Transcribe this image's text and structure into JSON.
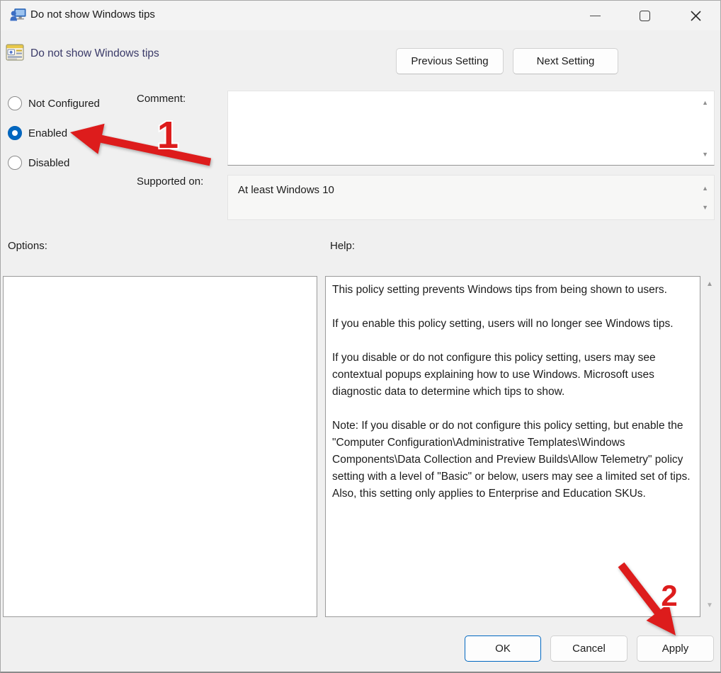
{
  "window": {
    "title": "Do not show Windows tips"
  },
  "header": {
    "title": "Do not show Windows tips",
    "previous_button": "Previous Setting",
    "next_button": "Next Setting"
  },
  "radios": {
    "selected": "Enabled",
    "items": [
      {
        "label": "Not Configured",
        "checked": false
      },
      {
        "label": "Enabled",
        "checked": true
      },
      {
        "label": "Disabled",
        "checked": false
      }
    ]
  },
  "comment": {
    "label": "Comment:",
    "value": ""
  },
  "supported": {
    "label": "Supported on:",
    "value": "At least Windows 10"
  },
  "options": {
    "label": "Options:"
  },
  "help": {
    "label": "Help:",
    "text": "This policy setting prevents Windows tips from being shown to users.\n\nIf you enable this policy setting, users will no longer see Windows tips.\n\nIf you disable or do not configure this policy setting, users may see contextual popups explaining how to use Windows. Microsoft uses diagnostic data to determine which tips to show.\n\nNote: If you disable or do not configure this policy setting, but enable the \"Computer Configuration\\Administrative Templates\\Windows Components\\Data Collection and Preview Builds\\Allow Telemetry\" policy setting with a level of \"Basic\" or below, users may see a limited set of tips.\nAlso, this setting only applies to Enterprise and Education SKUs."
  },
  "footer": {
    "ok": "OK",
    "cancel": "Cancel",
    "apply": "Apply"
  },
  "annotations": {
    "step1": "1",
    "step2": "2",
    "arrow_color": "#dd1c1c"
  },
  "icons": {
    "scroll_up": "▲",
    "scroll_down": "▼"
  },
  "colors": {
    "accent_blue": "#0067c0",
    "header_title": "#3a3a68",
    "window_bg": "#f0f0f0"
  }
}
